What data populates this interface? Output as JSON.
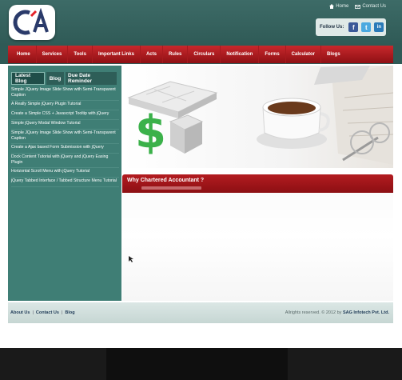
{
  "brand": {
    "logo_text": "CA"
  },
  "top_links": {
    "home": "Home",
    "contact": "Contact Us"
  },
  "follow": {
    "label": "Follow Us:",
    "facebook": "f",
    "twitter": "t",
    "linkedin": "in"
  },
  "nav": [
    "Home",
    "Services",
    "Tools",
    "Important Links",
    "Acts",
    "Rules",
    "Circulars",
    "Notification",
    "Forms",
    "Calculator",
    "Blogs"
  ],
  "sidebar": {
    "tabs": [
      "Latest Blog",
      "Blog",
      "Due Date Reminder"
    ],
    "items": [
      "Simple JQuery Image Slide Show with Semi-Transparent Caption",
      "A Really Simple jQuery Plugin Tutorial",
      "Create a Simple CSS + Javascript Tooltip with jQuery",
      "Simple jQuery Modal Window Tutorial",
      "Simple JQuery Image Slide Show with Semi-Transparent Caption",
      "Create a Ajax based Form Submission with jQuery",
      "Dock Content Tutorial with jQuery and jQuery Easing Plugin",
      "Horizontal Scroll Menu with jQuery Tutorial",
      "jQuery Tabbed Interface / Tabbed Structure Menu Tutorial"
    ]
  },
  "main": {
    "section_title": "Why Chartered Accountant ?"
  },
  "footer": {
    "links": [
      "About Us",
      "Contact Us",
      "Blog"
    ],
    "copyright_prefix": "Allrights reserved. © 2012 by",
    "company": "SAG Infotech Pvt. Ltd."
  },
  "colors": {
    "header": "#2f5a56",
    "nav_red": "#b31c20",
    "sidebar": "#3f7e75"
  }
}
